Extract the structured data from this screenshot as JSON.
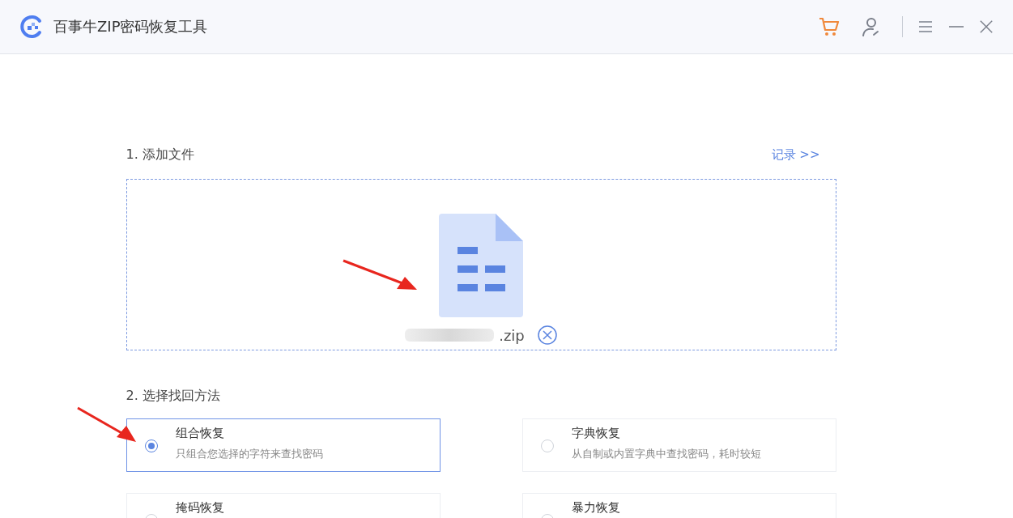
{
  "window": {
    "title": "百事牛ZIP密码恢复工具"
  },
  "step1": {
    "label": "1. 添加文件",
    "history_link": "记录 >>",
    "file": {
      "extension": ".zip"
    }
  },
  "step2": {
    "label": "2. 选择找回方法",
    "methods": [
      {
        "title": "组合恢复",
        "description": "只组合您选择的字符来查找密码",
        "selected": true
      },
      {
        "title": "字典恢复",
        "description": "从自制或内置字典中查找密码，耗时较短",
        "selected": false
      },
      {
        "title": "掩码恢复",
        "selected": false
      },
      {
        "title": "暴力恢复",
        "selected": false
      }
    ]
  }
}
